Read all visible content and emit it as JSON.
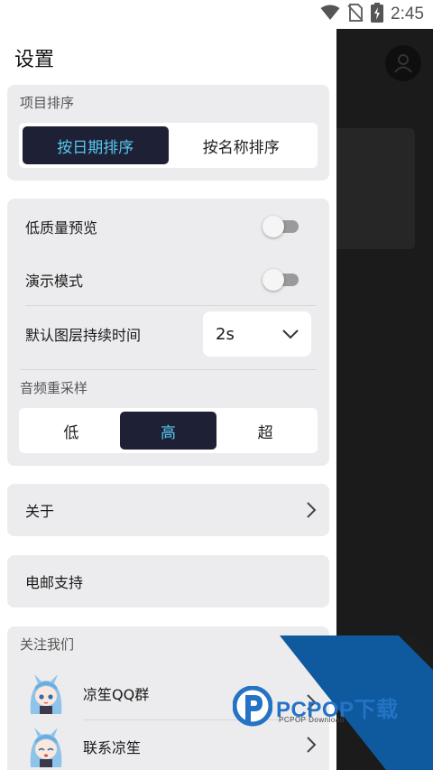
{
  "status_bar": {
    "time": "2:45",
    "icons": [
      "wifi-icon",
      "no-sim-icon",
      "battery-charging-icon"
    ]
  },
  "drawer": {
    "title": "设置",
    "sort": {
      "label": "项目排序",
      "options": [
        "按日期排序",
        "按名称排序"
      ],
      "selected": "按日期排序"
    },
    "preferences": {
      "low_quality_preview": {
        "label": "低质量预览",
        "enabled": false
      },
      "presentation_mode": {
        "label": "演示模式",
        "enabled": false
      },
      "default_layer_duration": {
        "label": "默认图层持续时间",
        "value": "2s"
      },
      "audio_resample": {
        "label": "音频重采样",
        "options": [
          "低",
          "高",
          "超"
        ],
        "selected": "高"
      }
    },
    "about": {
      "label": "关于"
    },
    "email_support": {
      "label": "电邮支持"
    },
    "follow_us": {
      "label": "关注我们",
      "items": [
        {
          "label": "凉笙QQ群",
          "icon": "anime-avatar-icon"
        },
        {
          "label": "联系凉笙",
          "icon": "anime-avatar-icon"
        }
      ]
    }
  },
  "watermark": {
    "title": "PCPOP下载",
    "subtitle": "PCPOP Download"
  },
  "colors": {
    "accent": "#58c7f0",
    "segment_active_bg": "#1e2135",
    "card_bg": "#ececee",
    "watermark_blue": "#0f5a9e"
  }
}
